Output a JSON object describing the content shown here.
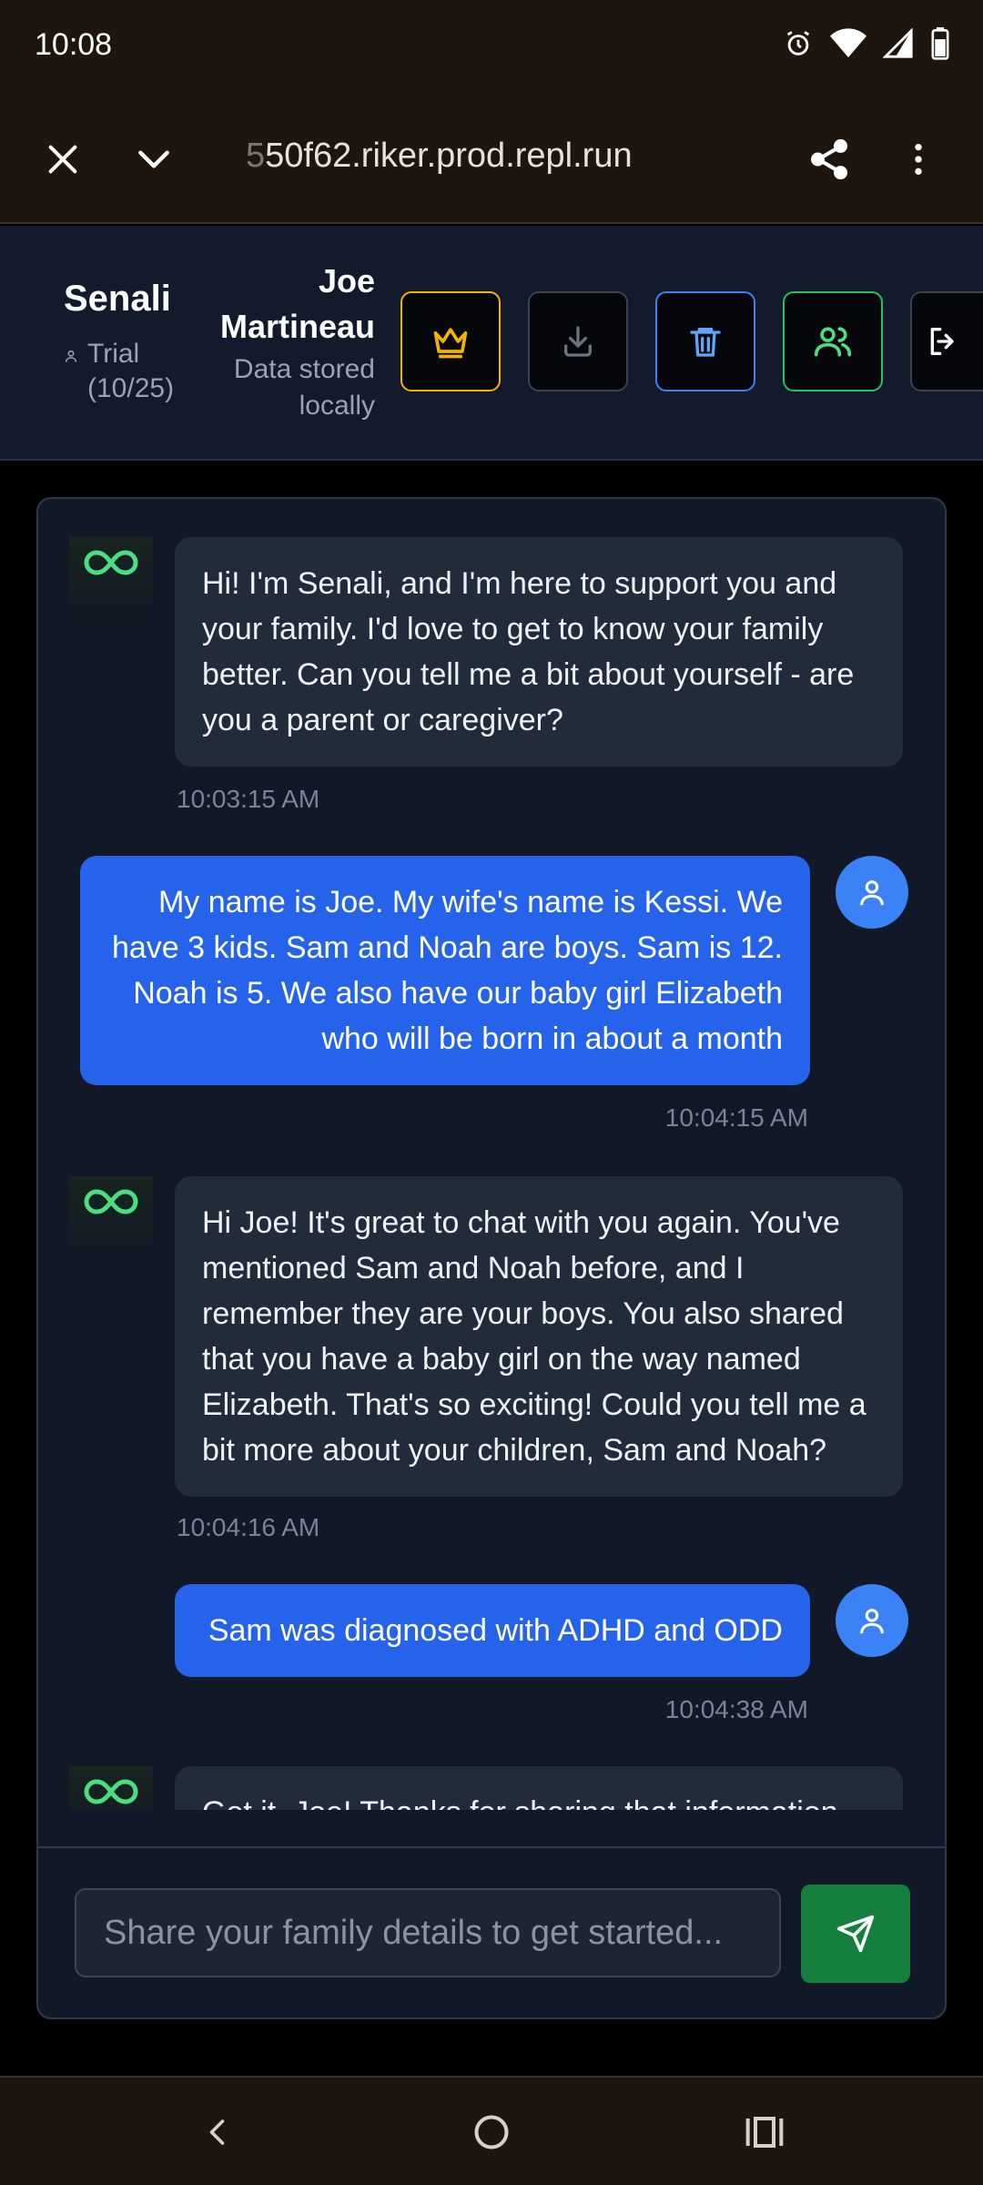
{
  "status_bar": {
    "time": "10:08",
    "icons": [
      "alarm-icon",
      "wifi-icon",
      "signal-icon",
      "battery-icon"
    ]
  },
  "browser": {
    "url_faded": "5",
    "url": "50f62.riker.prod.repl.run"
  },
  "header": {
    "brand": "Senali",
    "trial_line1": "Trial",
    "trial_line2": "(10/25)",
    "user_first": "Joe",
    "user_last": "Martineau",
    "storage_line1": "Data stored",
    "storage_line2": "locally"
  },
  "messages": [
    {
      "role": "bot",
      "text": "Hi! I'm Senali, and I'm here to support you and your family. I'd love to get to know your family better. Can you tell me a bit about yourself - are you a parent or caregiver?",
      "time": "10:03:15 AM"
    },
    {
      "role": "user",
      "text": "My name is Joe.  My wife's name is Kessi.  We have 3 kids.  Sam and Noah are boys.  Sam is 12.  Noah is 5.  We also have our baby girl Elizabeth who will be born in about a month",
      "time": "10:04:15 AM"
    },
    {
      "role": "bot",
      "text": "Hi Joe! It's great to chat with you again. You've mentioned Sam and Noah before, and I remember they are your boys. You also shared that you have a baby girl on the way named Elizabeth. That's so exciting! Could you tell me a bit more about your children, Sam and Noah?",
      "time": "10:04:16 AM"
    },
    {
      "role": "user",
      "text": "Sam was diagnosed with ADHD and ODD",
      "time": "10:04:38 AM"
    },
    {
      "role": "bot",
      "text": "Got it, Joe! Thanks for sharing that information",
      "time": ""
    }
  ],
  "input": {
    "placeholder": "Share your family details to get started..."
  },
  "colors": {
    "accent_blue": "#2563eb",
    "send_green": "#15803d",
    "infinity_green": "#4ade80",
    "crown_gold": "#f5b301"
  }
}
